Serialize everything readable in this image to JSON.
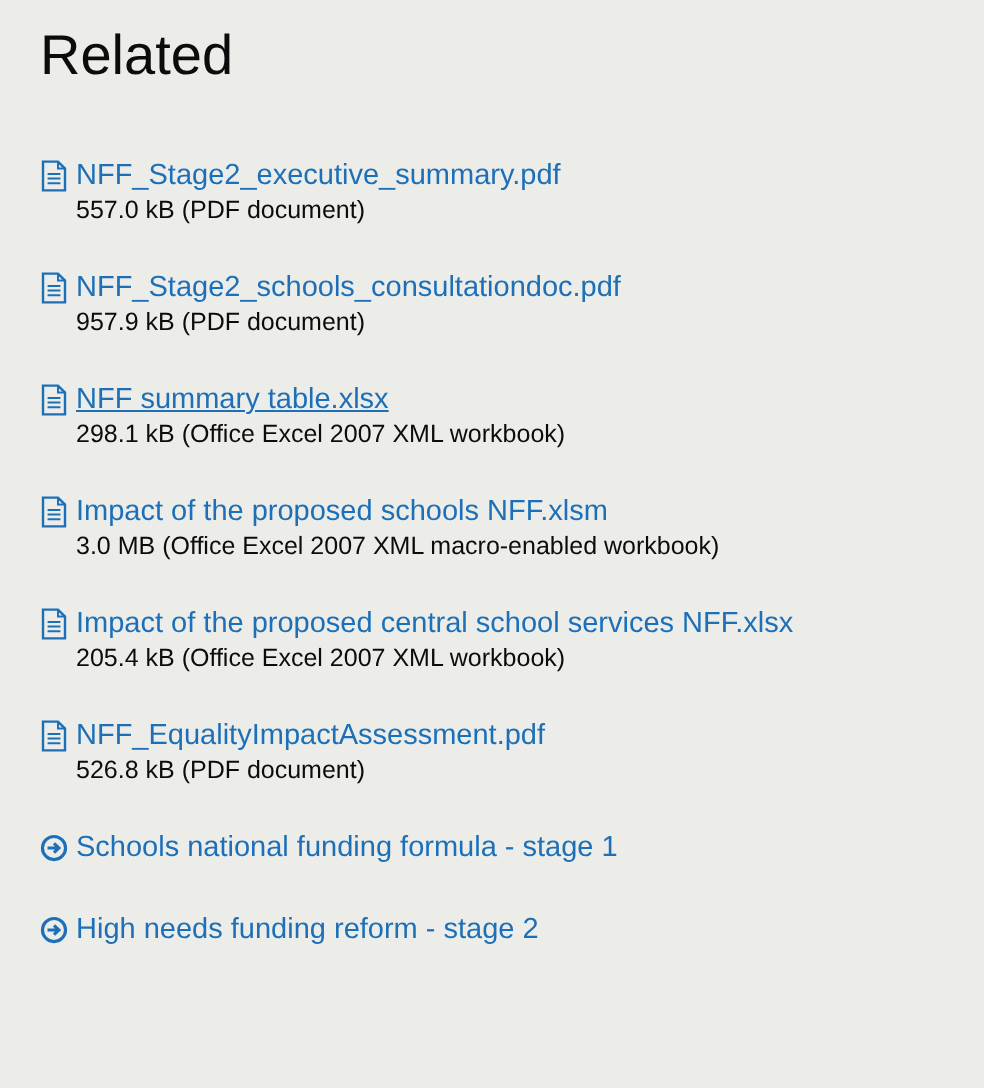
{
  "heading": "Related",
  "items": [
    {
      "kind": "file",
      "title": "NFF_Stage2_executive_summary.pdf",
      "meta": "557.0 kB (PDF document)",
      "hovered": false
    },
    {
      "kind": "file",
      "title": "NFF_Stage2_schools_consultationdoc.pdf",
      "meta": "957.9 kB (PDF document)",
      "hovered": false
    },
    {
      "kind": "file",
      "title": "NFF summary table.xlsx",
      "meta": "298.1 kB (Office Excel 2007 XML workbook)",
      "hovered": true
    },
    {
      "kind": "file",
      "title": "Impact of the proposed schools NFF.xlsm",
      "meta": "3.0 MB (Office Excel 2007 XML macro-enabled workbook)",
      "hovered": false
    },
    {
      "kind": "file",
      "title": "Impact of the proposed central school services NFF.xlsx",
      "meta": "205.4 kB (Office Excel 2007 XML workbook)",
      "hovered": false
    },
    {
      "kind": "file",
      "title": "NFF_EqualityImpactAssessment.pdf",
      "meta": "526.8 kB (PDF document)",
      "hovered": false
    },
    {
      "kind": "page",
      "title": "Schools national funding formula - stage 1"
    },
    {
      "kind": "page",
      "title": "High needs funding reform - stage 2"
    }
  ]
}
